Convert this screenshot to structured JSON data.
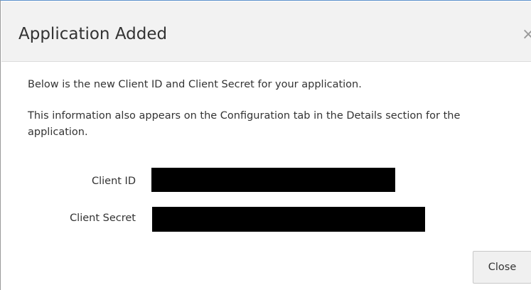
{
  "dialog": {
    "title": "Application Added",
    "close_icon_glyph": "×",
    "message_1": "Below is the new Client ID and Client Secret for your application.",
    "message_2": "This information also appears on the Configuration tab in the Details section for the application.",
    "fields": {
      "client_id_label": "Client ID",
      "client_id_value": "",
      "client_secret_label": "Client Secret",
      "client_secret_value": ""
    },
    "close_button_label": "Close"
  },
  "icons": {
    "close": "close-icon"
  },
  "colors": {
    "header_bg": "#f2f2f2",
    "redaction": "#000000",
    "button_bg": "#f0f0f0",
    "text": "#333333"
  }
}
